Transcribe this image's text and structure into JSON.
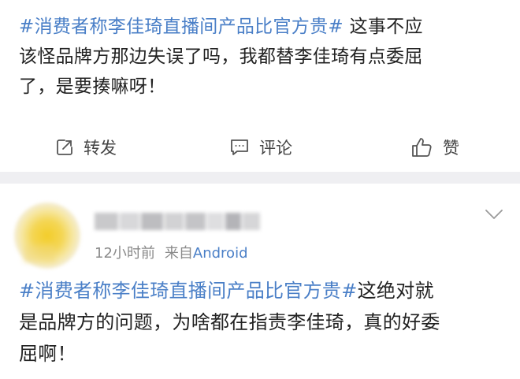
{
  "post1": {
    "text_hashtag": "#消费者称李佳琦直播间产品比官方贵#",
    "text_line1_rest": " 这事不应",
    "text_line2": "该怪品牌方那边失误了吗，我都替李佳琦有点委屈",
    "text_line3": "了，是要揍嘛呀！",
    "actions": {
      "repost_label": "转发",
      "comment_label": "评论",
      "like_label": "赞"
    }
  },
  "post2": {
    "time": "12小时前",
    "source_prefix": "来自",
    "source_app": "Android",
    "text_hashtag": "#消费者称李佳琦直播间产品比官方贵#",
    "text_line1_rest": "这绝对就",
    "text_line2": "是品牌方的问题，为啥都在指责李佳琦，真的好委",
    "text_line3": "屈啊！"
  },
  "colors": {
    "hashtag": "#4a7fc7",
    "divider": "#efeff2",
    "meta": "#8a8a8a"
  },
  "icons": {
    "repost": "edit-square-icon",
    "comment": "comment-bubble-icon",
    "like": "thumbs-up-icon",
    "more": "chevron-down-icon"
  }
}
